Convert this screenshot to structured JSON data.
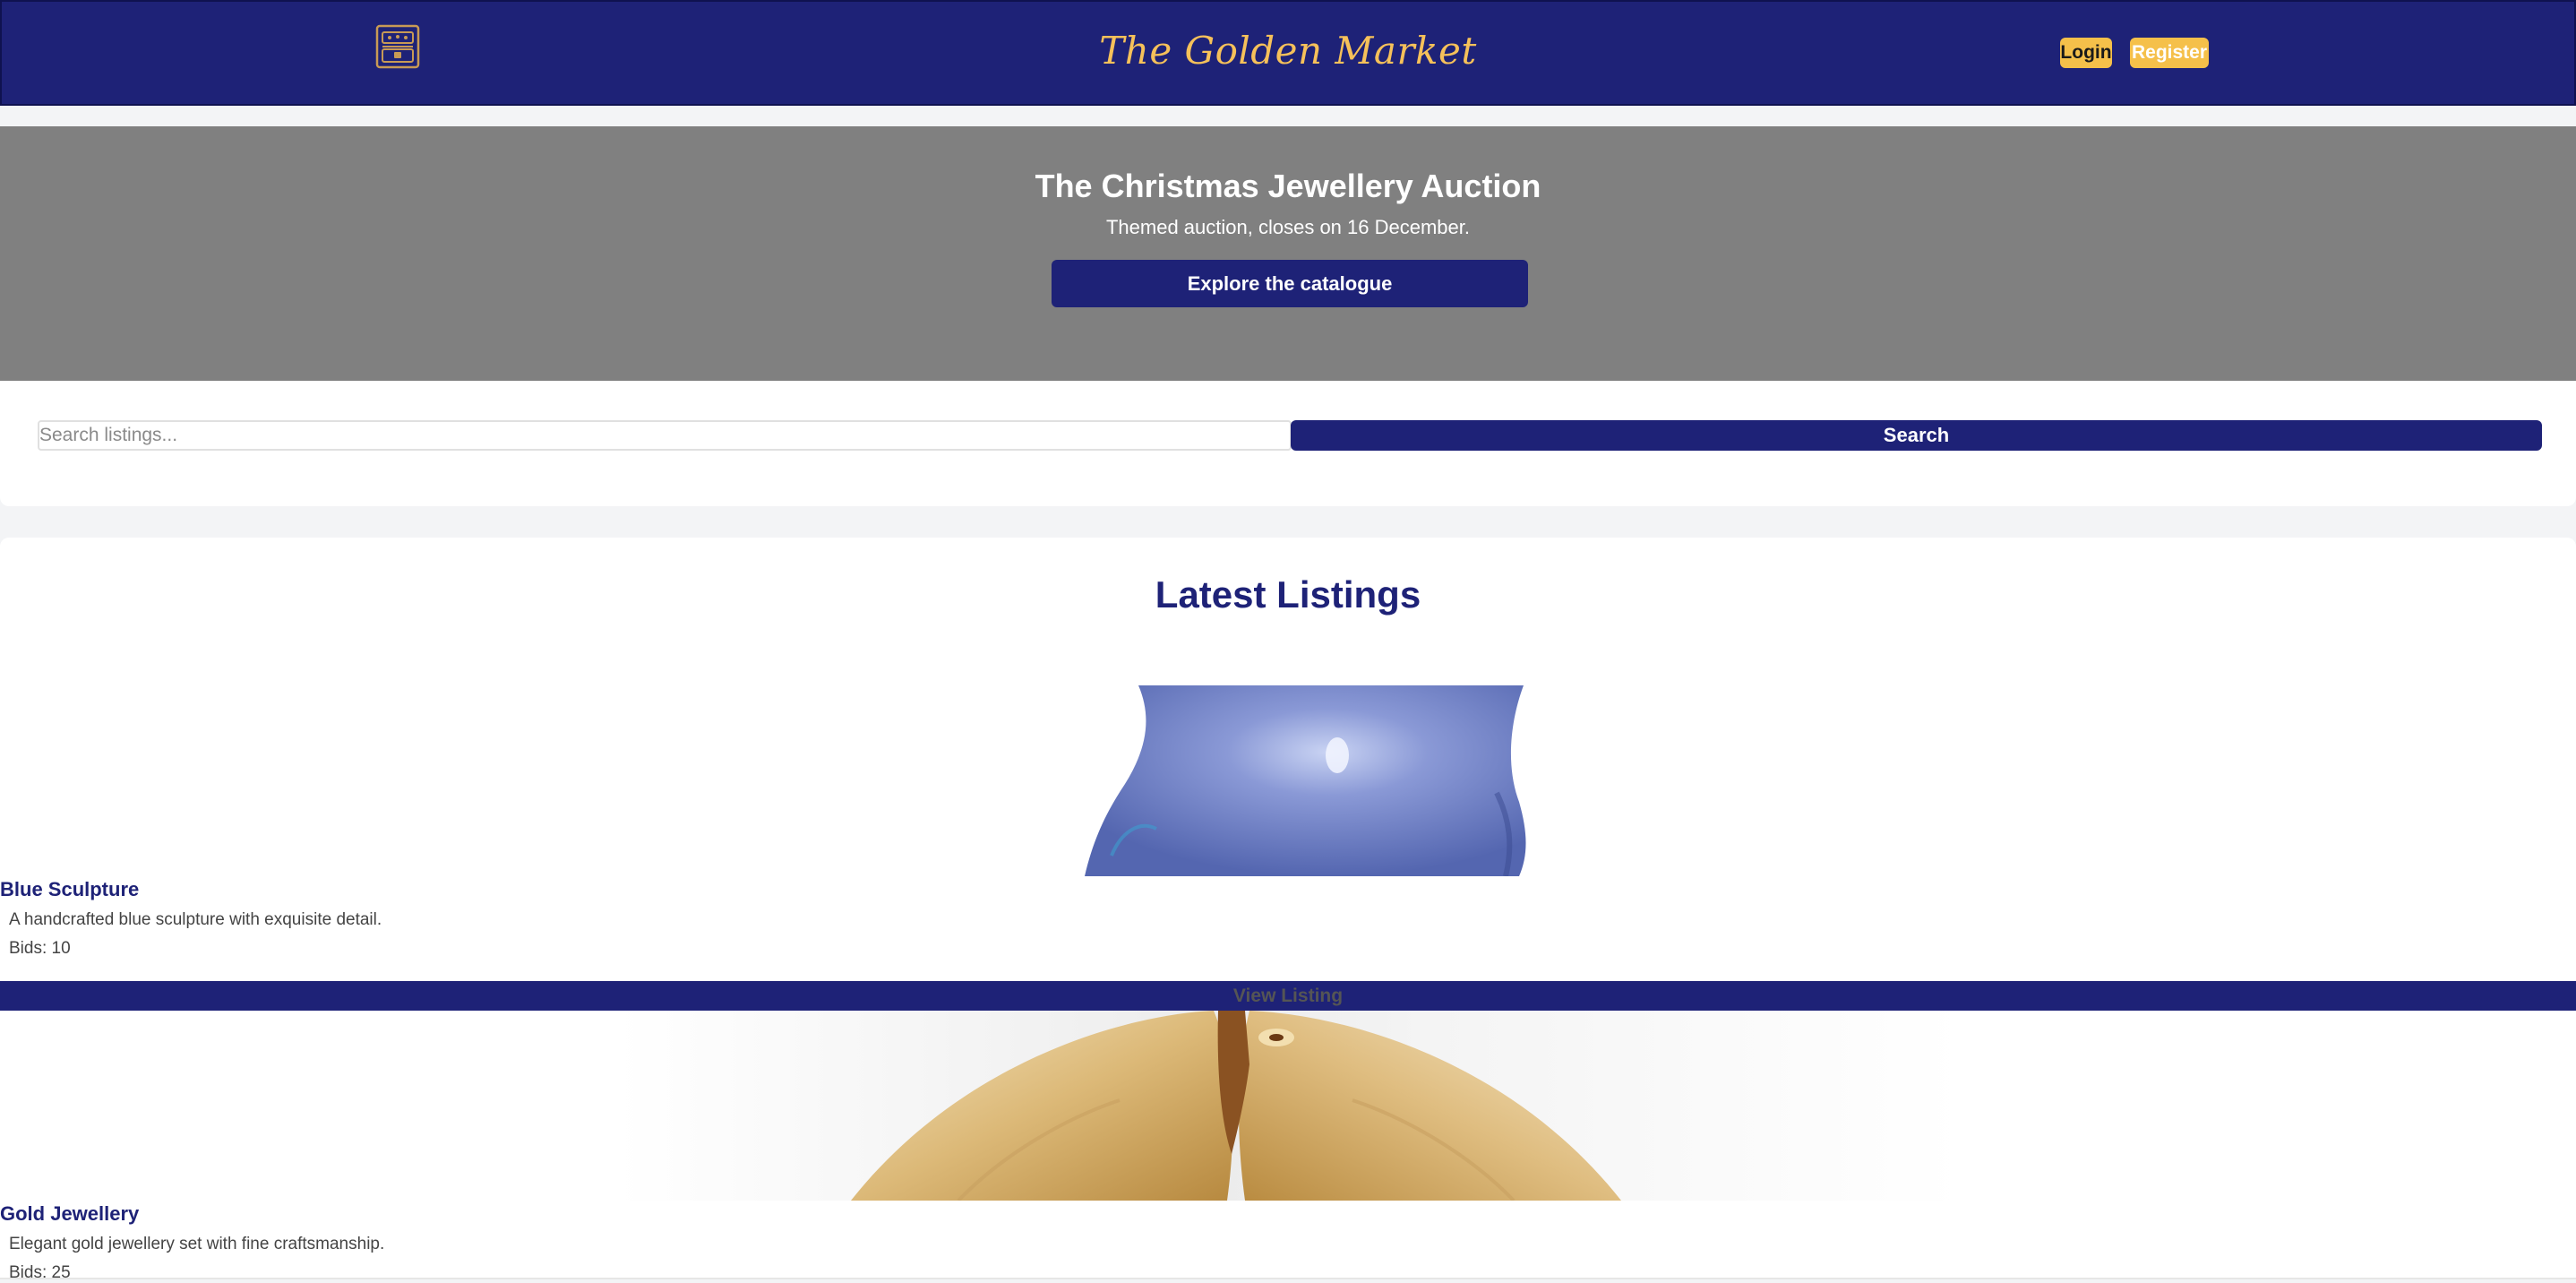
{
  "header": {
    "site_title": "The Golden Market",
    "logo_icon": "treasure-chest-icon",
    "login_label": "Login",
    "register_label": "Register",
    "colors": {
      "navy": "#1e2277",
      "gold": "#f5c04a"
    }
  },
  "hero": {
    "title": "The Christmas Jewellery Auction",
    "subtitle": "Themed auction, closes on 16 December.",
    "button_label": "Explore the catalogue",
    "background": "#808080"
  },
  "search": {
    "placeholder": "Search listings...",
    "value": "",
    "button_label": "Search"
  },
  "listings": {
    "title": "Latest Listings",
    "items": [
      {
        "name": "Blue Sculpture",
        "description": "A handcrafted blue sculpture with exquisite detail.",
        "bids": "Bids: 10",
        "button_label": "View Listing",
        "image_icon": "blue-sculpture-image"
      },
      {
        "name": "Gold Jewellery",
        "description": "Elegant gold jewellery set with fine craftsmanship.",
        "bids": "Bids: 25",
        "image_icon": "gold-jewellery-image"
      }
    ]
  }
}
